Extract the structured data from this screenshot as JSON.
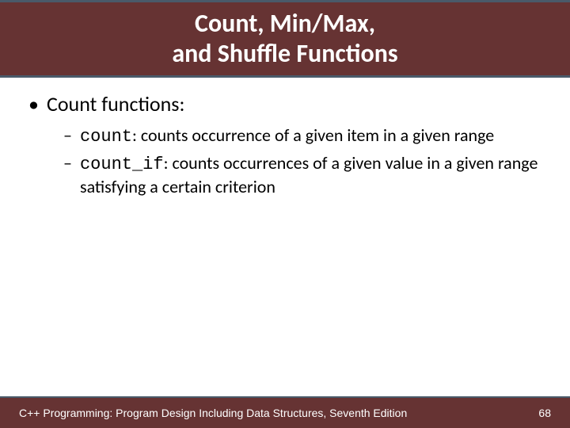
{
  "title": {
    "line1": "Count, Min/Max,",
    "line2": "and Shuffle Functions"
  },
  "bullets": {
    "main": "Count functions:",
    "sub1_code": "count",
    "sub1_rest": ": counts occurrence of a given item in a given range",
    "sub2_code": "count_if",
    "sub2_rest": ": counts occurrences of a given value in a given range satisfying a certain criterion"
  },
  "footer": {
    "text": "C++ Programming: Program Design Including Data Structures, Seventh Edition",
    "page": "68"
  }
}
